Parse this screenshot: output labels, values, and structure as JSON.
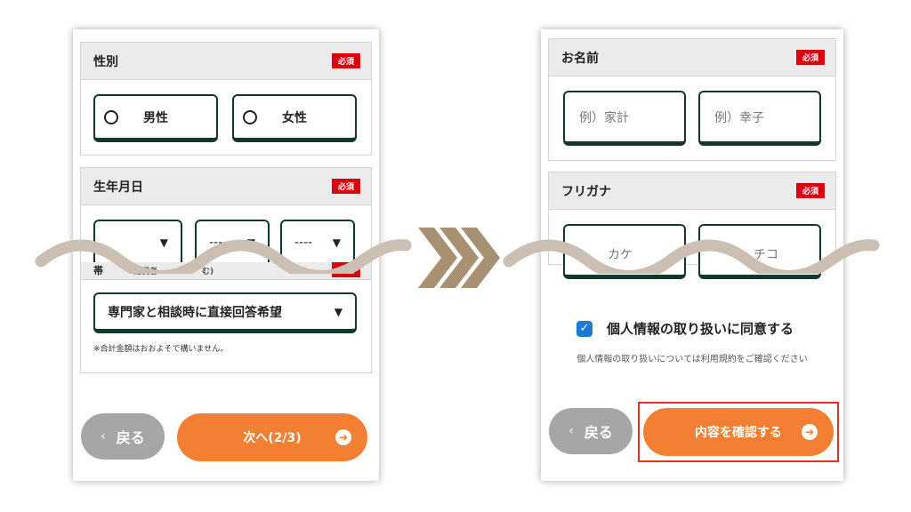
{
  "left_screen": {
    "gender": {
      "title": "性別",
      "required": "必須",
      "options": [
        "男性",
        "女性"
      ]
    },
    "birthdate": {
      "title": "生年月日",
      "required": "必須",
      "selects": [
        "----",
        "----"
      ]
    },
    "obscured_section": {
      "title_fragment": "帯",
      "title_fragment2": "配偶者",
      "title_fragment3": "む)",
      "required": "必須"
    },
    "income": {
      "selected": "専門家と相談時に直接回答希望",
      "note": "※合計金額はおおよそで構いません。"
    },
    "back_label": "戻る",
    "next_label": "次へ(2/3)"
  },
  "right_screen": {
    "name": {
      "title": "お名前",
      "required": "必須",
      "last_placeholder": "例）家計",
      "first_placeholder": "例）幸子"
    },
    "furigana": {
      "title": "フリガナ",
      "required": "必須",
      "last_fragment": "カケ",
      "first_fragment": "チコ"
    },
    "consent_label": "個人情報の取り扱いに同意する",
    "consent_note": "個人情報の取り扱いについては利用規約をご確認ください",
    "back_label": "戻る",
    "confirm_label": "内容を確認する"
  },
  "icons": {
    "back": "chevron-left-icon",
    "next": "arrow-right-circle-icon",
    "select": "triangle-down-icon",
    "check": "checkmark-icon"
  },
  "colors": {
    "accent_orange": "#f27f32",
    "required_red": "#d9000f",
    "border_green": "#13382a",
    "back_gray": "#a6a6a6",
    "checkbox_blue": "#1e78d6",
    "wave_beige": "#cbbfb3",
    "chevron_brown": "#a89172",
    "highlight_red": "#e0312b"
  }
}
